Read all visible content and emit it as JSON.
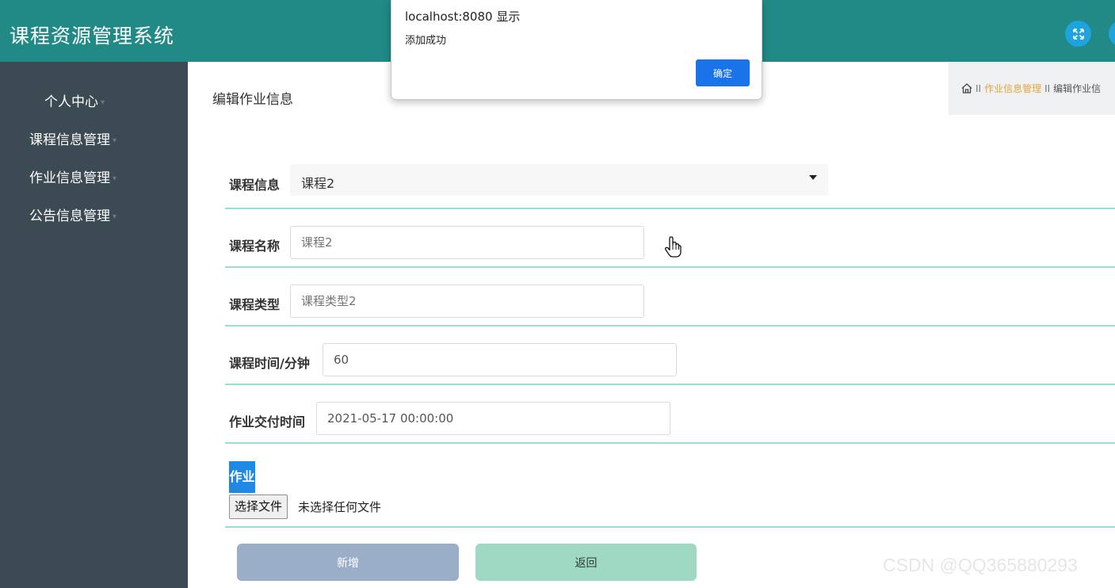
{
  "app": {
    "title": "课程资源管理系统"
  },
  "header": {
    "fullscreen_icon": "⤧"
  },
  "sidebar": {
    "items": [
      {
        "label": "个人中心"
      },
      {
        "label": "课程信息管理"
      },
      {
        "label": "作业信息管理"
      },
      {
        "label": "公告信息管理"
      }
    ]
  },
  "page": {
    "title": "编辑作业信息"
  },
  "breadcrumb": {
    "home_icon": "home-icon",
    "sep": "II",
    "items": [
      "作业信息管理",
      "编辑作业信"
    ]
  },
  "form": {
    "course_info": {
      "label": "课程信息",
      "value": "课程2"
    },
    "course_name": {
      "label": "课程名称",
      "placeholder": "课程2"
    },
    "course_type": {
      "label": "课程类型",
      "placeholder": "课程类型2"
    },
    "course_time": {
      "label": "课程时间/分钟",
      "value": "60"
    },
    "due_time": {
      "label": "作业交付时间",
      "value": "2021-05-17 00:00:00"
    },
    "homework": {
      "label": "作业",
      "choose_button": "选择文件",
      "status": "未选择任何文件"
    },
    "add_button": "新增",
    "back_button": "返回"
  },
  "dialog": {
    "title": "localhost:8080 显示",
    "message": "添加成功",
    "ok_button": "确定"
  },
  "watermark": "CSDN @QQ365880293",
  "colors": {
    "header": "#218a86",
    "sidebar": "#3c4a53",
    "row_line": "#9ddcd2",
    "add_button": "#9aaec8",
    "back_button": "#9fd9c4",
    "dialog_ok": "#1a73e8"
  }
}
